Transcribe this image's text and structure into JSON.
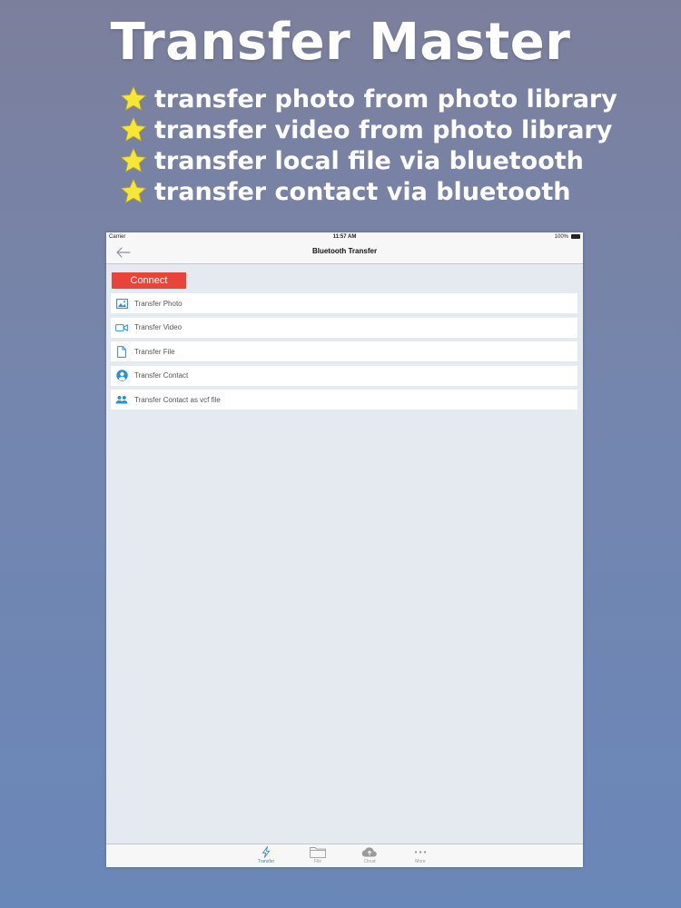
{
  "promo": {
    "title": "Transfer Master",
    "features": [
      "transfer photo from photo library",
      "transfer video from photo library",
      "transfer local file via bluetooth",
      "transfer contact via bluetooth"
    ],
    "star_color": "#f5e63a"
  },
  "status_bar": {
    "carrier": "Carrier",
    "time": "11:57 AM",
    "battery": "100%"
  },
  "nav": {
    "back_icon": "back-arrow-icon",
    "title": "Bluetooth Transfer"
  },
  "connect_button": {
    "label": "Connect",
    "color": "#e8443a"
  },
  "menu": {
    "items": [
      {
        "label": "Transfer Photo",
        "icon": "photo-icon"
      },
      {
        "label": "Transfer Video",
        "icon": "video-icon"
      },
      {
        "label": "Transfer File",
        "icon": "file-icon"
      },
      {
        "label": "Transfer Contact",
        "icon": "contact-icon"
      },
      {
        "label": "Transfer Contact as vcf file",
        "icon": "contacts-group-icon"
      }
    ]
  },
  "tabbar": {
    "tabs": [
      {
        "label": "Transfer",
        "icon": "bolt-icon",
        "active": true
      },
      {
        "label": "File",
        "icon": "folder-icon",
        "active": false
      },
      {
        "label": "Cloud",
        "icon": "cloud-icon",
        "active": false
      },
      {
        "label": "More",
        "icon": "more-icon",
        "active": false
      }
    ],
    "active_color": "#2a8fd8"
  }
}
